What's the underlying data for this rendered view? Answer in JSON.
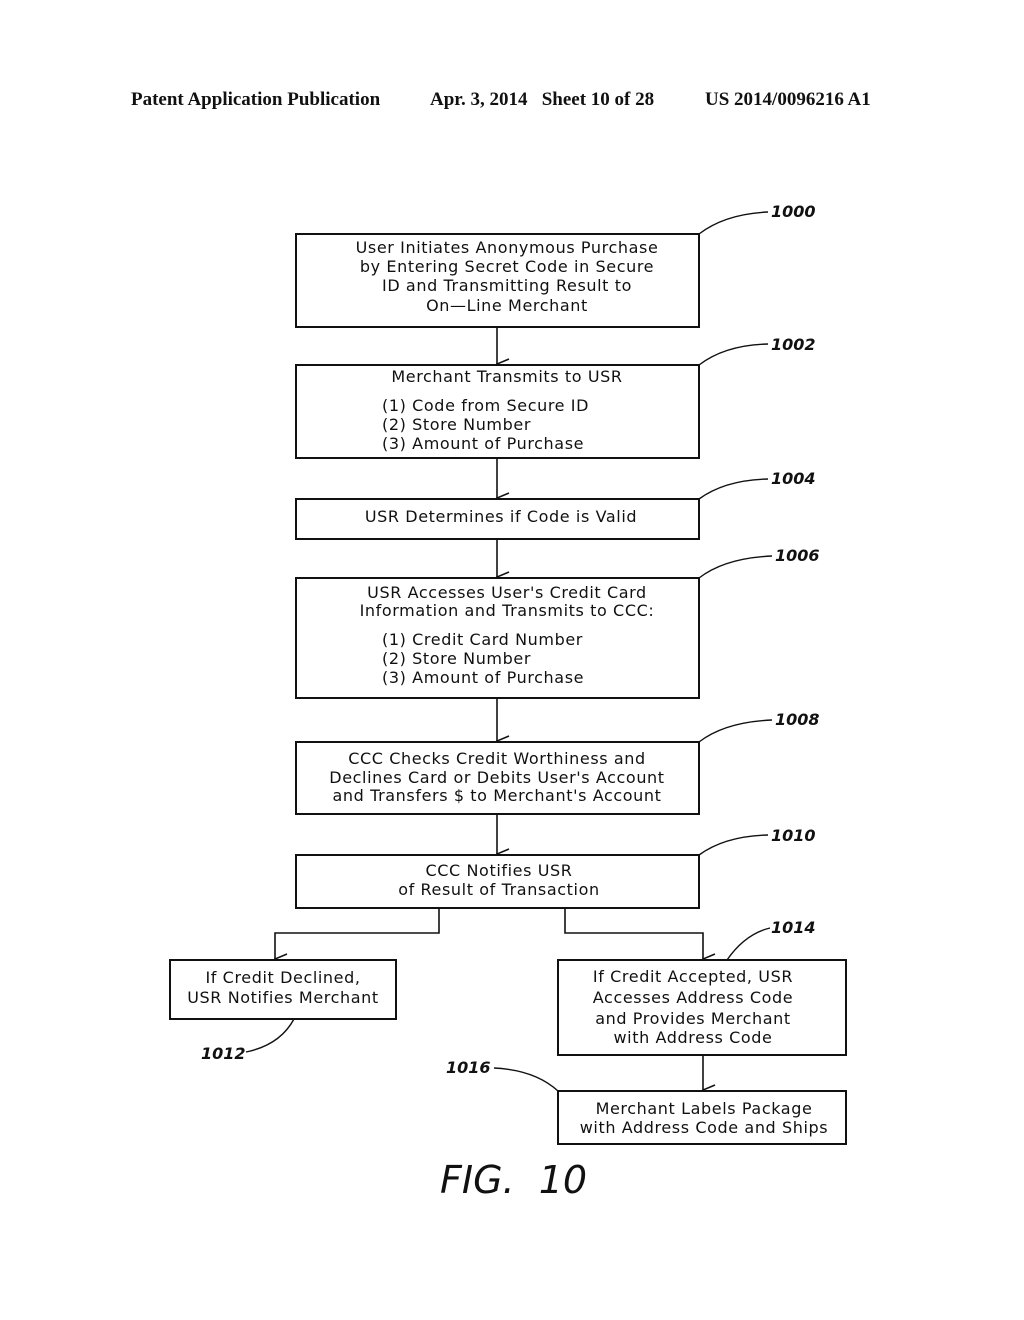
{
  "header": {
    "left": "Patent Application Publication",
    "middle": "Apr. 3, 2014   Sheet 10 of 28",
    "right": "US 2014/0096216 A1"
  },
  "figure_label": "FIG.  10",
  "steps": {
    "s1000": {
      "ref": "1000",
      "lines": [
        "User Initiates Anonymous Purchase",
        "by Entering Secret Code in Secure",
        "ID and Transmitting Result to",
        "On—Line Merchant"
      ]
    },
    "s1002": {
      "ref": "1002",
      "title": "Merchant Transmits to USR",
      "items": [
        "(1)  Code from Secure ID",
        "(2)  Store Number",
        "(3)  Amount of Purchase"
      ]
    },
    "s1004": {
      "ref": "1004",
      "lines": [
        "USR Determines if Code is Valid"
      ]
    },
    "s1006": {
      "ref": "1006",
      "title_lines": [
        "USR Accesses User's Credit Card",
        "Information and Transmits to CCC:"
      ],
      "items": [
        "(1)  Credit Card Number",
        "(2)  Store Number",
        "(3)  Amount of Purchase"
      ]
    },
    "s1008": {
      "ref": "1008",
      "lines": [
        "CCC Checks Credit Worthiness and",
        "Declines Card or Debits User's Account",
        "and Transfers $ to Merchant's Account"
      ]
    },
    "s1010": {
      "ref": "1010",
      "lines": [
        "CCC Notifies USR",
        "of Result of Transaction"
      ]
    },
    "s1012": {
      "ref": "1012",
      "lines": [
        "If Credit Declined,",
        "USR Notifies Merchant"
      ]
    },
    "s1014": {
      "ref": "1014",
      "lines": [
        "If Credit Accepted, USR",
        "Accesses Address Code",
        "and Provides Merchant",
        "with Address Code"
      ]
    },
    "s1016": {
      "ref": "1016",
      "lines": [
        "Merchant Labels Package",
        "with Address Code and Ships"
      ]
    }
  }
}
